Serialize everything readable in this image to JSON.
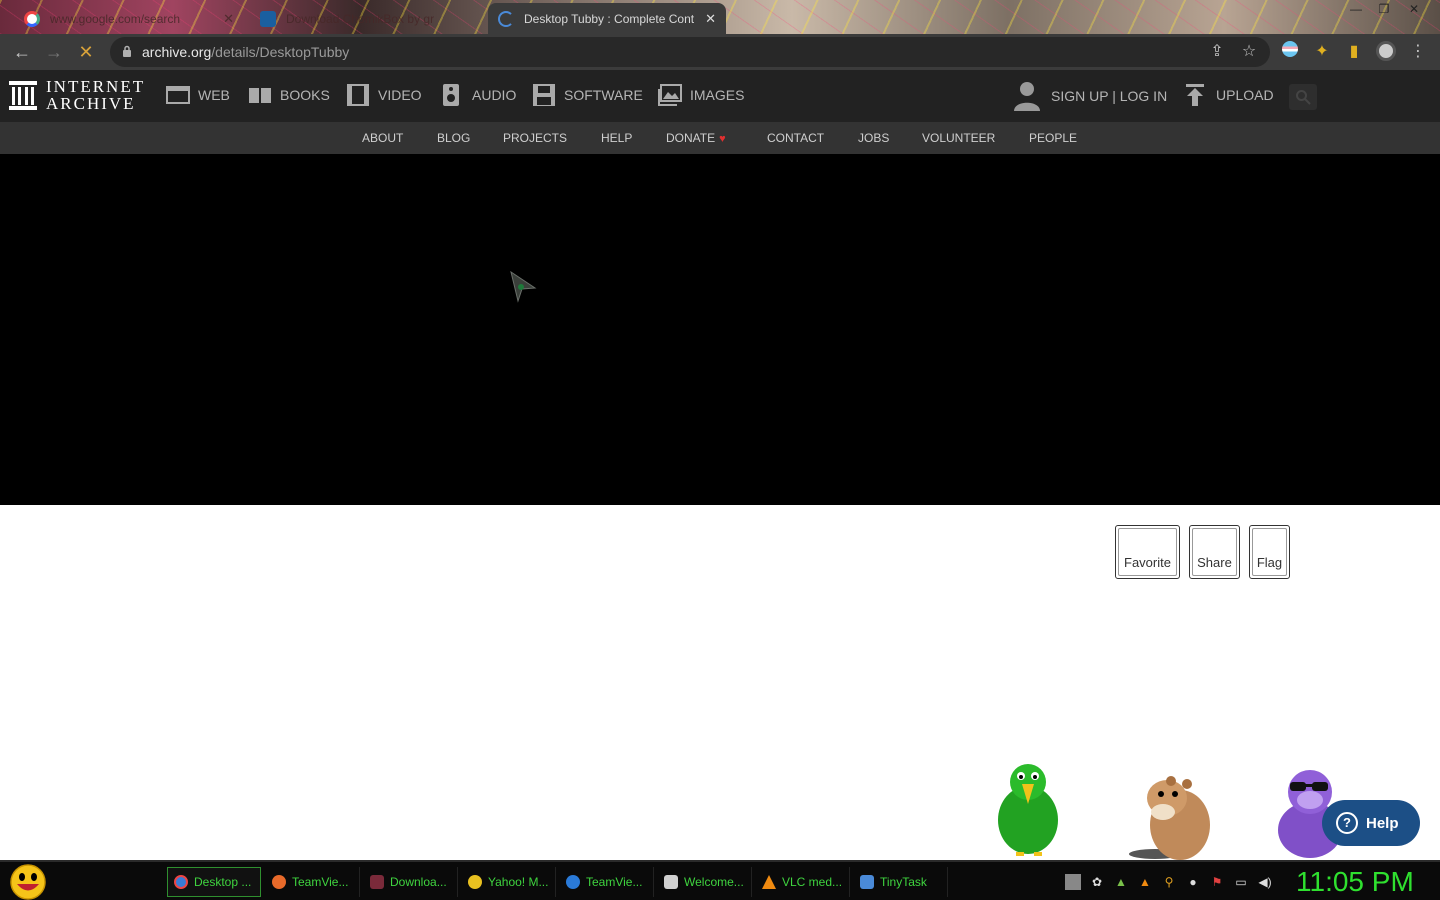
{
  "browser": {
    "tabs": [
      {
        "title": "www.google.com/search",
        "icon": "google-icon",
        "state": "inactive"
      },
      {
        "title": "Download ChomikBox by gr",
        "icon": "chomikbox-icon",
        "state": "inactive"
      },
      {
        "title": "Desktop Tubby : Complete Cont",
        "icon": "loading-spinner-icon",
        "state": "active"
      }
    ],
    "tab_close": "✕",
    "url_host": "archive.org",
    "url_path": "/details/DesktopTubby",
    "buttons": {
      "back": "←",
      "forward": "→",
      "stop": "✕",
      "share": "⇪",
      "bookmark": "☆",
      "menu": "⋮"
    }
  },
  "ia": {
    "logo_line1": "INTERNET",
    "logo_line2": "ARCHIVE",
    "nav": [
      {
        "label": "WEB",
        "icon": "web-icon"
      },
      {
        "label": "BOOKS",
        "icon": "book-icon"
      },
      {
        "label": "VIDEO",
        "icon": "film-icon"
      },
      {
        "label": "AUDIO",
        "icon": "speaker-icon"
      },
      {
        "label": "SOFTWARE",
        "icon": "floppy-icon"
      },
      {
        "label": "IMAGES",
        "icon": "image-icon"
      }
    ],
    "signup": "SIGN UP | LOG IN",
    "upload": "UPLOAD",
    "sub_nav": [
      "ABOUT",
      "BLOG",
      "PROJECTS",
      "HELP",
      "DONATE",
      "CONTACT",
      "JOBS",
      "VOLUNTEER",
      "PEOPLE"
    ],
    "donate_heart": "♥"
  },
  "actions": {
    "favorite": "Favorite",
    "share": "Share",
    "flag": "Flag"
  },
  "help": {
    "label": "Help",
    "icon_glyph": "?"
  },
  "taskbar": {
    "items": [
      {
        "label": "Desktop ...",
        "icon_color": "#3a7bd5",
        "active": true
      },
      {
        "label": "TeamVie...",
        "icon_color": "#e86a2a",
        "active": false
      },
      {
        "label": "Downloa...",
        "icon_color": "#7a2a3a",
        "active": false
      },
      {
        "label": "Yahoo! M...",
        "icon_color": "#e8c020",
        "active": false
      },
      {
        "label": "TeamVie...",
        "icon_color": "#2a7ad8",
        "active": false
      },
      {
        "label": "Welcome...",
        "icon_color": "#d0d0d0",
        "active": false
      },
      {
        "label": "VLC med...",
        "icon_color": "#f08a10",
        "active": false
      },
      {
        "label": "TinyTask",
        "icon_color": "#4a8ad8",
        "active": false
      }
    ],
    "clock": "11:05 PM"
  },
  "colors": {
    "taskbar_text": "#3fd43f",
    "help_bg": "#1c4f86",
    "ia_header": "#222222"
  }
}
